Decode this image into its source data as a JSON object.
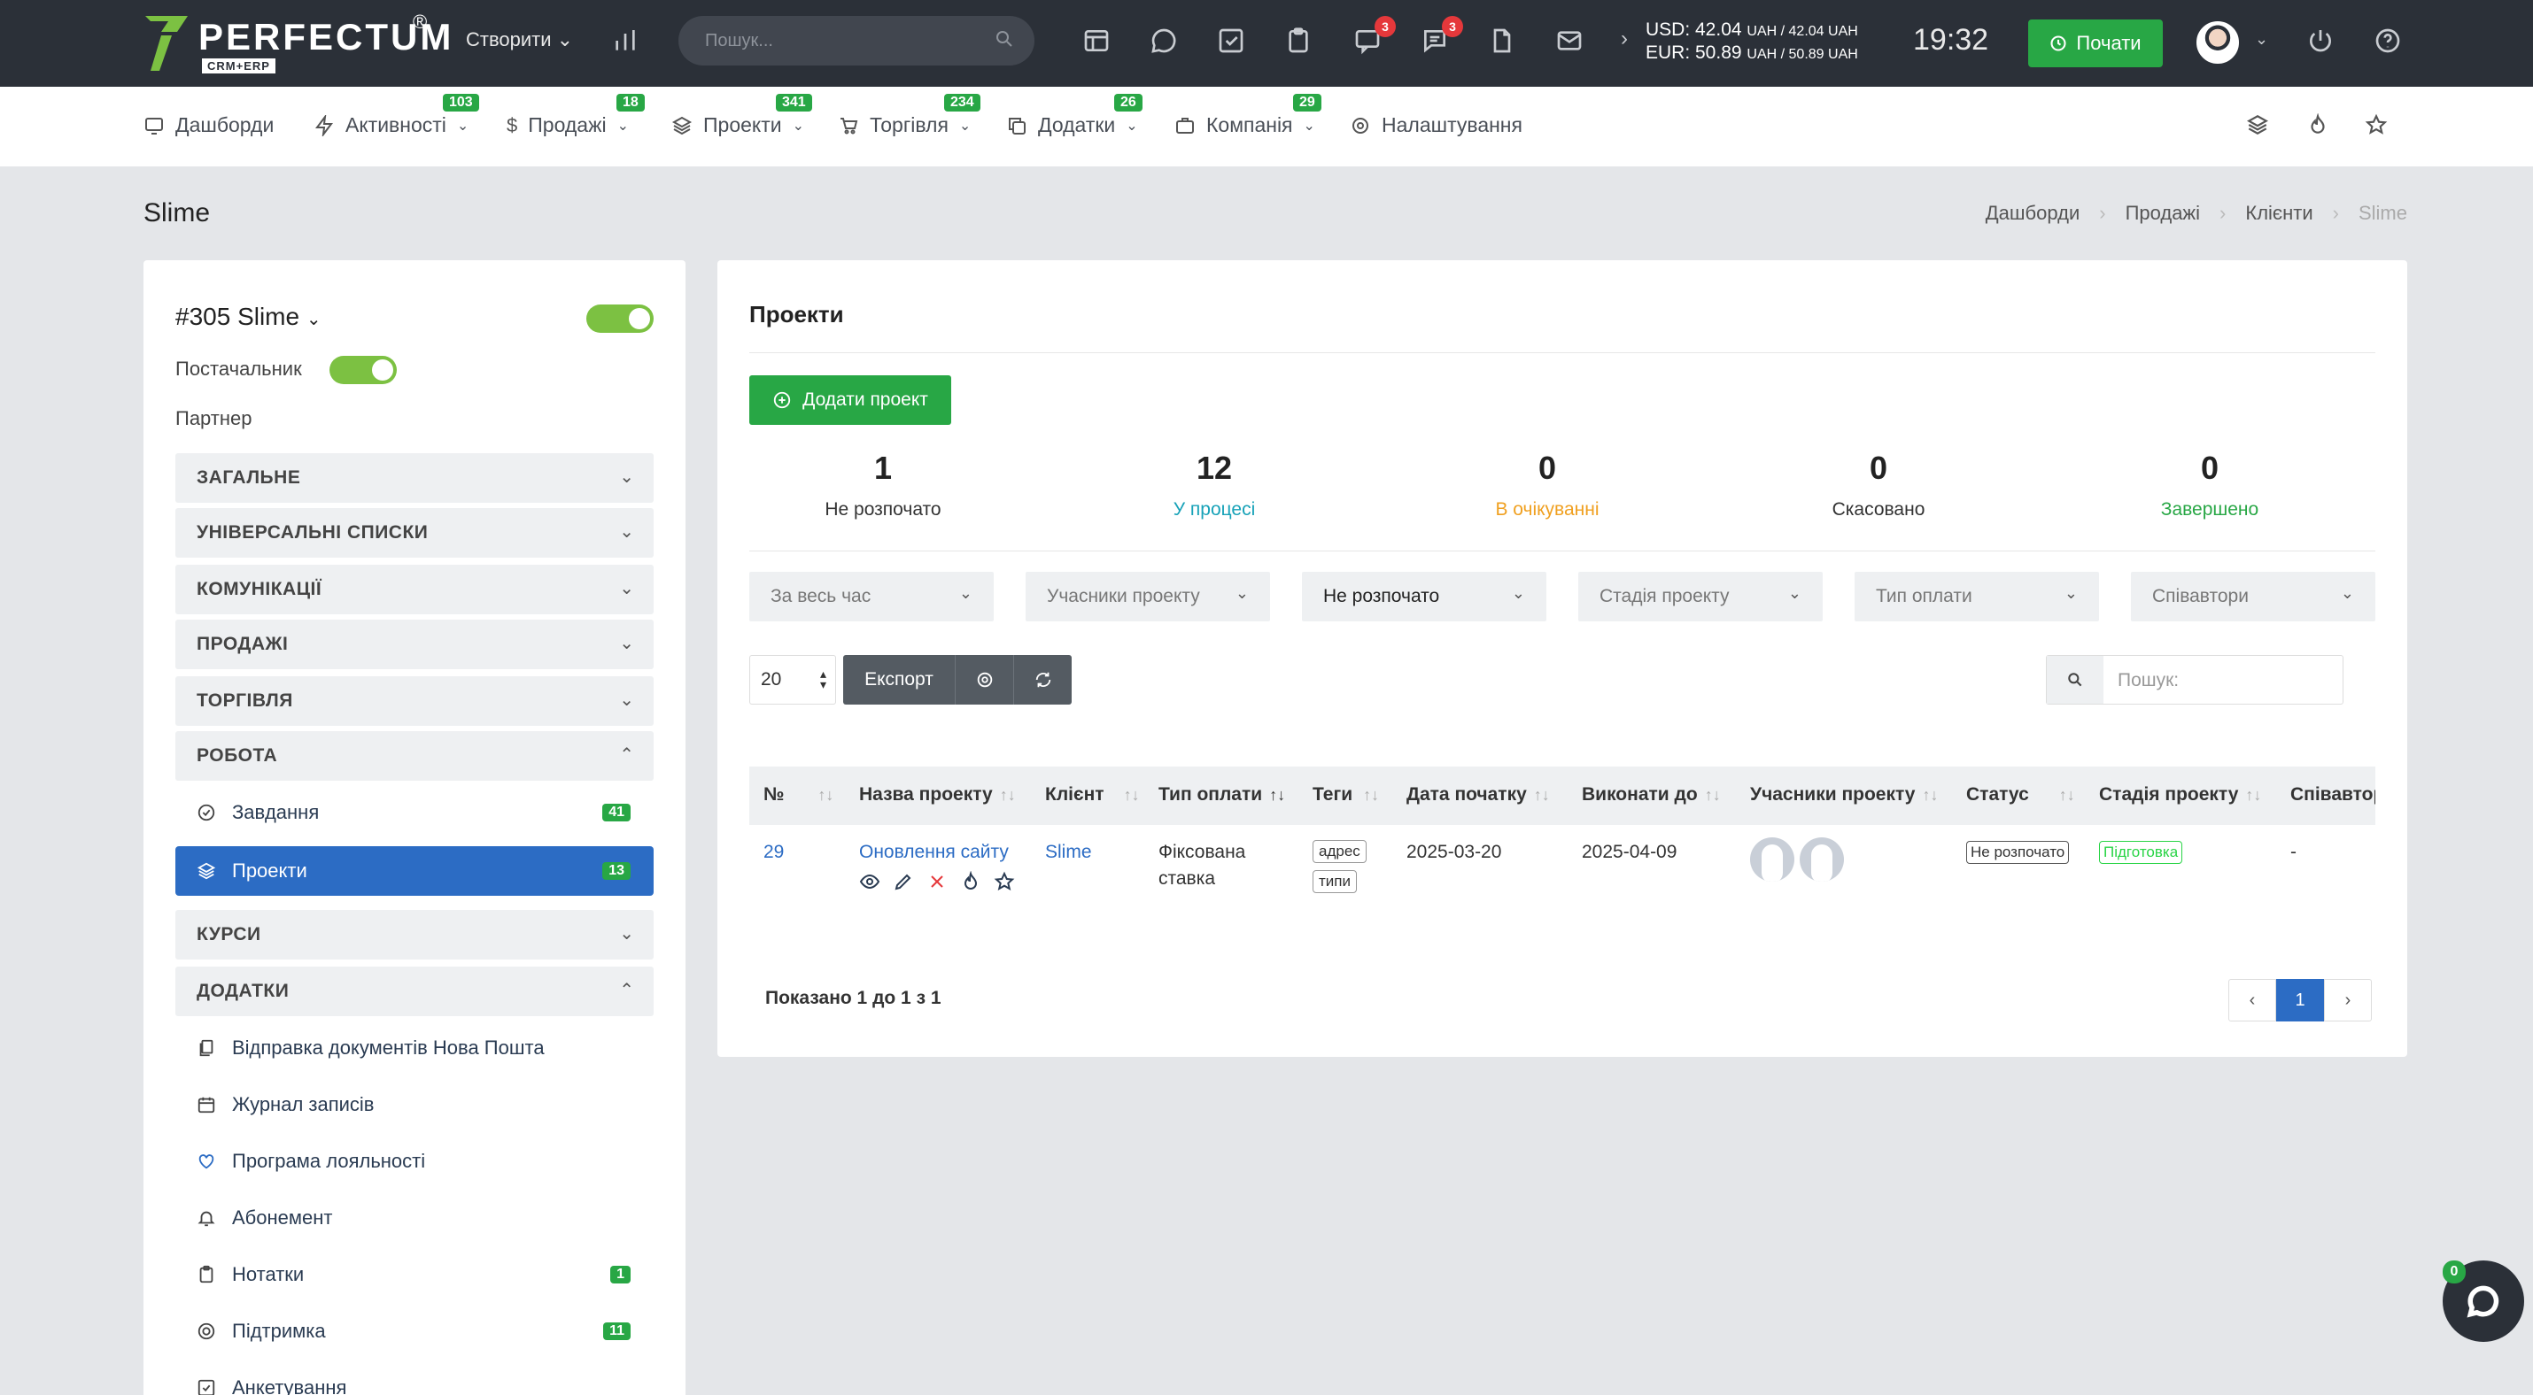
{
  "topbar": {
    "logo_text": "PERFECTUM",
    "logo_reg": "®",
    "logo_sub": "CRM+ERP",
    "create_label": "Створити",
    "search_placeholder": "Пошук...",
    "badges": {
      "chat": "3",
      "messages": "3"
    },
    "currency_usd": "USD: 42.04",
    "currency_usd_rest": "UAH / 42.04 UAH",
    "currency_eur": "EUR: 50.89",
    "currency_eur_rest": "UAH / 50.89 UAH",
    "clock": "19:32",
    "start_label": "Почати"
  },
  "nav": {
    "items": [
      {
        "label": "Дашборди",
        "badge": ""
      },
      {
        "label": "Активності",
        "badge": "103"
      },
      {
        "label": "Продажі",
        "badge": "18"
      },
      {
        "label": "Проекти",
        "badge": "341"
      },
      {
        "label": "Торгівля",
        "badge": "234"
      },
      {
        "label": "Додатки",
        "badge": "26"
      },
      {
        "label": "Компанія",
        "badge": "29"
      },
      {
        "label": "Налаштування",
        "badge": ""
      }
    ]
  },
  "page": {
    "title": "Slime",
    "breadcrumb": [
      "Дашборди",
      "Продажі",
      "Клієнти",
      "Slime"
    ]
  },
  "client": {
    "name": "#305 Slime",
    "supplier_label": "Постачальник",
    "partner_label": "Партнер",
    "sections": [
      {
        "label": "ЗАГАЛЬНЕ"
      },
      {
        "label": "УНІВЕРСАЛЬНІ СПИСКИ"
      },
      {
        "label": "КОМУНІКАЦІЇ"
      },
      {
        "label": "ПРОДАЖІ"
      },
      {
        "label": "ТОРГІВЛЯ"
      },
      {
        "label": "РОБОТА"
      },
      {
        "label": "КУРСИ"
      },
      {
        "label": "ДОДАТКИ"
      }
    ],
    "work_items": [
      {
        "label": "Завдання",
        "count": "41"
      },
      {
        "label": "Проекти",
        "count": "13"
      }
    ],
    "addon_items": [
      {
        "label": "Відправка документів Нова Пошта",
        "count": ""
      },
      {
        "label": "Журнал записів",
        "count": ""
      },
      {
        "label": "Програма лояльності",
        "count": ""
      },
      {
        "label": "Абонемент",
        "count": ""
      },
      {
        "label": "Нотатки",
        "count": "1"
      },
      {
        "label": "Підтримка",
        "count": "11"
      },
      {
        "label": "Анкетування",
        "count": ""
      }
    ]
  },
  "projects": {
    "title": "Проекти",
    "add_label": "Додати проект",
    "stats": [
      {
        "num": "1",
        "label": "Не розпочато",
        "color": "#333333"
      },
      {
        "num": "12",
        "label": "У процесі",
        "color": "#17a2b8"
      },
      {
        "num": "0",
        "label": "В очікуванні",
        "color": "#f0a020"
      },
      {
        "num": "0",
        "label": "Скасовано",
        "color": "#333333"
      },
      {
        "num": "0",
        "label": "Завершено",
        "color": "#28a745"
      }
    ],
    "filters": [
      "За весь час",
      "Учасники проекту",
      "Не розпочато",
      "Стадія проекту",
      "Тип оплати",
      "Співавтори"
    ],
    "page_size": "20",
    "export_label": "Експорт",
    "search_placeholder": "Пошук:",
    "columns": [
      "№",
      "Назва проекту",
      "Клієнт",
      "Тип оплати",
      "Теги",
      "Дата початку",
      "Виконати до",
      "Учасники проекту",
      "Статус",
      "Стадія проекту",
      "Співавтори"
    ],
    "rows": [
      {
        "id": "29",
        "name": "Оновлення сайту",
        "client": "Slime",
        "payment_line1": "Фіксована",
        "payment_line2": "ставка",
        "tags": [
          "адрес",
          "типи"
        ],
        "start": "2025-03-20",
        "due": "2025-04-09",
        "status": "Не розпочато",
        "stage": "Підготовка",
        "coauthors": "-"
      }
    ],
    "shown_text": "Показано 1 до 1 з 1",
    "pager": {
      "prev": "‹",
      "page": "1",
      "next": "›"
    }
  },
  "chat": {
    "badge": "0"
  }
}
